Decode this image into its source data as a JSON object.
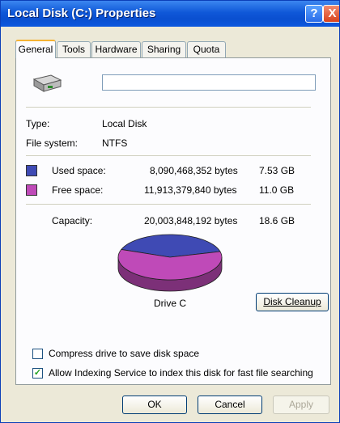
{
  "window": {
    "title": "Local Disk (C:) Properties",
    "help_label": "?",
    "close_label": "X"
  },
  "tabs": [
    {
      "label": "General"
    },
    {
      "label": "Tools"
    },
    {
      "label": "Hardware"
    },
    {
      "label": "Sharing"
    },
    {
      "label": "Quota"
    }
  ],
  "general": {
    "name_value": "",
    "type_label": "Type:",
    "type_value": "Local Disk",
    "fs_label": "File system:",
    "fs_value": "NTFS",
    "used": {
      "label": "Used space:",
      "bytes": "8,090,468,352 bytes",
      "size": "7.53 GB",
      "color": "#3f4ab4"
    },
    "free": {
      "label": "Free space:",
      "bytes": "11,913,379,840 bytes",
      "size": "11.0 GB",
      "color": "#bf4ab8"
    },
    "capacity": {
      "label": "Capacity:",
      "bytes": "20,003,848,192 bytes",
      "size": "18.6 GB"
    },
    "drive_label": "Drive C",
    "cleanup_button": "Disk Cleanup"
  },
  "chart_data": {
    "type": "pie",
    "title": "",
    "slices": [
      {
        "name": "Used space",
        "value": 8090468352,
        "color": "#3f4ab4"
      },
      {
        "name": "Free space",
        "value": 11913379840,
        "color": "#bf4ab8"
      }
    ]
  },
  "options": {
    "compress": {
      "label": "Compress drive to save disk space",
      "checked": false
    },
    "index": {
      "label": "Allow Indexing Service to index this disk for fast file searching",
      "checked": true
    }
  },
  "buttons": {
    "ok": "OK",
    "cancel": "Cancel",
    "apply": "Apply"
  }
}
